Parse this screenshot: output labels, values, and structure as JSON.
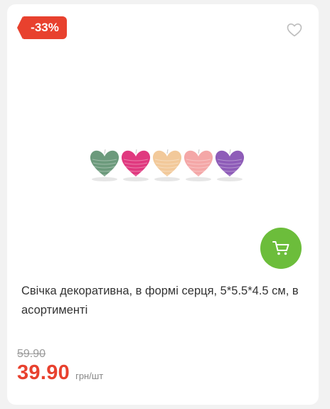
{
  "badge": {
    "discount": "-33%"
  },
  "product": {
    "title": "Свічка декоративна, в формі серця, 5*5.5*4.5 см, в асортименті",
    "image_alt": "decorative heart candles assortment",
    "candle_colors": [
      "#6c9a7c",
      "#e0397f",
      "#f2c99a",
      "#f4a7a7",
      "#8e5cb8"
    ]
  },
  "price": {
    "old": "59.90",
    "current": "39.90",
    "unit": "грн/шт"
  },
  "icons": {
    "favorite": "heart-outline-icon",
    "cart": "cart-icon"
  },
  "colors": {
    "accent_red": "#e8412e",
    "cart_green": "#6cbd3b"
  }
}
